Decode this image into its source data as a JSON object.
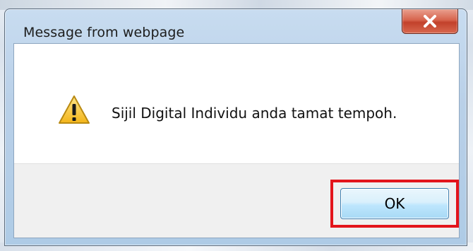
{
  "dialog": {
    "title": "Message from webpage",
    "message": "Sijil Digital Individu anda tamat tempoh.",
    "icon": "warning-icon",
    "ok_label": "OK",
    "close_icon": "close-icon"
  },
  "colors": {
    "highlight_border": "#e3141b",
    "close_button": "#c2412b",
    "ok_button": "#bee6fd"
  }
}
